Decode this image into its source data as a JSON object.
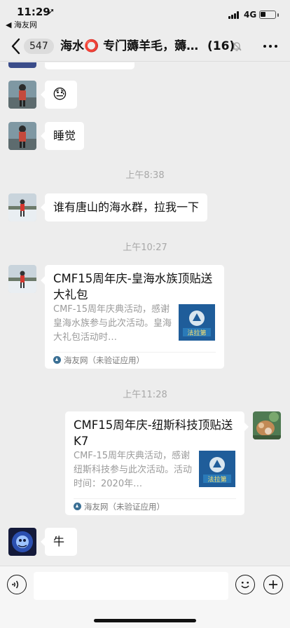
{
  "status_bar": {
    "time": "11:29",
    "location_arrow": "➚",
    "back_app": "◀ 海友网",
    "network": "4G",
    "battery_level": 0.35
  },
  "nav": {
    "unread_count": "547",
    "title": "海水⭕ 专门薅羊毛，薅…",
    "member_count": "(16)",
    "icons": {
      "back": "chevron-left-icon",
      "mute": "bell-slash-icon",
      "more": "more-dots-icon"
    }
  },
  "messages": {
    "partial_top": "",
    "emoji_reply": "😓",
    "sleep": "睡觉",
    "time_1": "上午8:38",
    "tangshan": "谁有唐山的海水群，拉我一下",
    "time_2": "上午10:27",
    "card_1": {
      "title": "CMF15周年庆-皇海水族顶贴送大礼包",
      "desc": "CMF-15周年庆典活动，感谢皇海水族参与此次活动。皇海大礼包活动时…",
      "source": "海友网（未验证应用）",
      "thumb_text": "法拉第"
    },
    "time_3": "上午11:28",
    "card_2": {
      "title": "CMF15周年庆-纽斯科技顶贴送K7",
      "desc": "CMF-15周年庆典活动，感谢纽斯科技参与此次活动。活动时间：2020年…",
      "source": "海友网（未验证应用）",
      "thumb_text": "法拉第"
    },
    "niu": "牛"
  },
  "input_bar": {
    "placeholder": "",
    "icons": {
      "voice": "voice-icon",
      "emoji": "emoji-icon",
      "plus": "plus-icon"
    }
  },
  "colors": {
    "background": "#ededed",
    "bubble": "#ffffff",
    "timestamp": "#a8a8a8",
    "thumb_blue": "#1f5d9a"
  }
}
